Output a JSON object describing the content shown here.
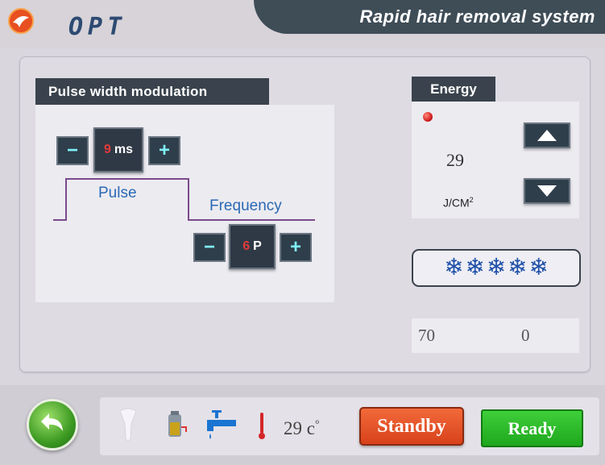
{
  "header": {
    "brand": "OPT",
    "title": "Rapid hair removal system"
  },
  "pulse": {
    "header": "Pulse width modulation",
    "width_value": "9",
    "width_unit": "ms",
    "pulse_label": "Pulse",
    "frequency_label": "Frequency",
    "freq_value": "6",
    "freq_unit": "P",
    "minus": "−",
    "plus": "+"
  },
  "energy": {
    "header": "Energy",
    "value": "29",
    "unit": "J/CM",
    "unit_sup": "2"
  },
  "cooling": {
    "level": 5,
    "max": 5,
    "flake": "❄"
  },
  "counters": {
    "left": "70",
    "right": "0"
  },
  "status": {
    "temperature": "29",
    "temperature_unit": "c",
    "temperature_sup": "°"
  },
  "buttons": {
    "standby": "Standby",
    "ready": "Ready"
  },
  "colors": {
    "accent_cyan": "#7ff1f7",
    "value_red": "#e33a3a",
    "label_blue": "#2b69b6",
    "standby": "#e6512a",
    "ready": "#2cbc29"
  }
}
